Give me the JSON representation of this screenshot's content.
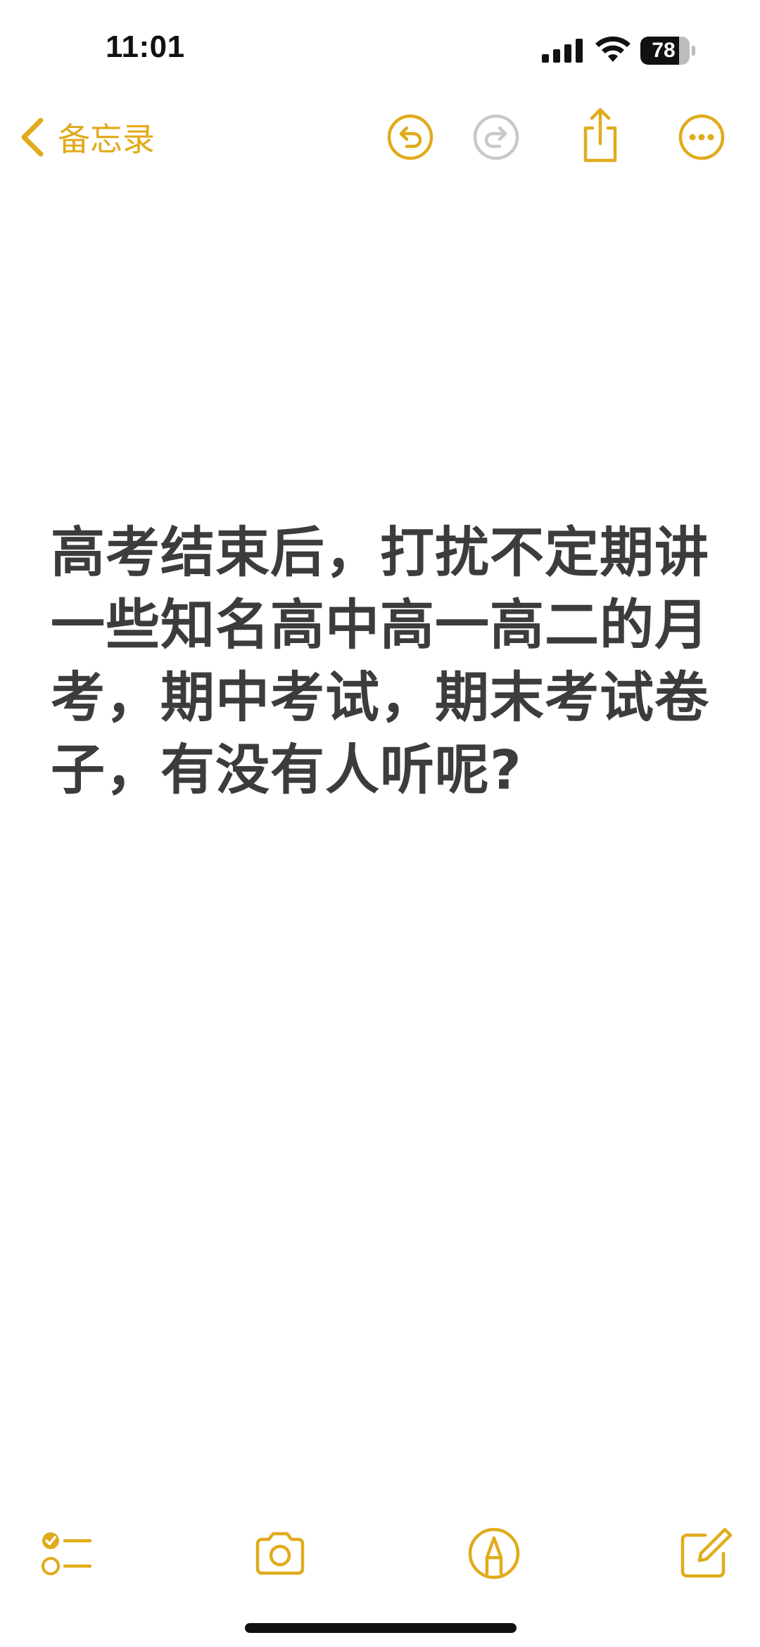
{
  "status_bar": {
    "time": "11:01",
    "battery_level": "78",
    "battery_fraction": 0.78,
    "icons": [
      "cellular-signal-icon",
      "wifi-icon",
      "battery-icon"
    ]
  },
  "nav": {
    "back_label": "备忘录",
    "icons": [
      "chevron-left-icon",
      "undo-icon",
      "redo-icon",
      "share-icon",
      "more-icon"
    ]
  },
  "note": {
    "text": "高考结束后，打扰不定期讲一些知名高中高一高二的月考，期中考试，期末考试卷子，有没有人听呢?"
  },
  "toolbar": {
    "icons": [
      "checklist-icon",
      "camera-icon",
      "markup-pen-icon",
      "compose-icon"
    ]
  },
  "colors": {
    "accent": "#e0ab1c",
    "accent_disabled": "#c8c8c8",
    "note_text": "#3c3c3c",
    "background": "#ffffff"
  }
}
